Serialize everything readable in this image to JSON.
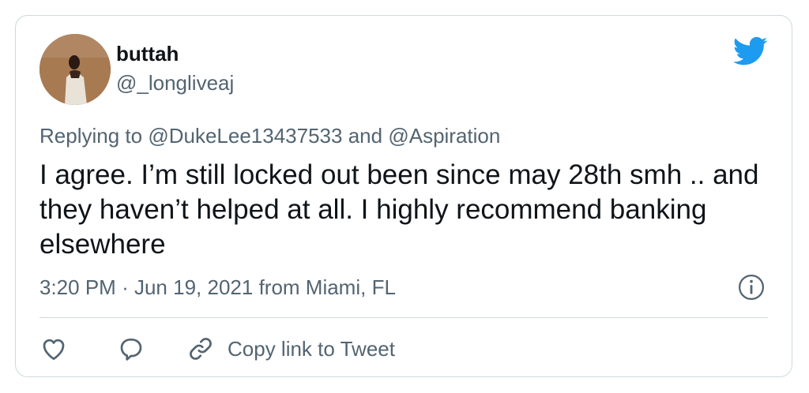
{
  "author": {
    "display_name": "buttah",
    "handle": "@_longliveaj"
  },
  "reply": {
    "prefix": "Replying to",
    "mention_1": "@DukeLee13437533",
    "joiner": "and",
    "mention_2": "@Aspiration"
  },
  "tweet": {
    "text": "I agree. I’m still locked out been since may 28th smh .. and they haven’t helped at all. I highly recommend banking elsewhere"
  },
  "meta": {
    "time": "3:20 PM",
    "separator": "·",
    "date": "Jun 19, 2021",
    "location": "from Miami, FL"
  },
  "actions": {
    "copy_link_label": "Copy link to Tweet"
  },
  "icons": {
    "brand": "twitter-bird-icon",
    "info": "info-icon",
    "like": "heart-icon",
    "reply": "reply-bubble-icon",
    "link": "link-icon"
  },
  "colors": {
    "twitter_blue": "#1d9bf0",
    "text_primary": "#0f1419",
    "text_secondary": "#536471",
    "border": "#cfd9de"
  }
}
